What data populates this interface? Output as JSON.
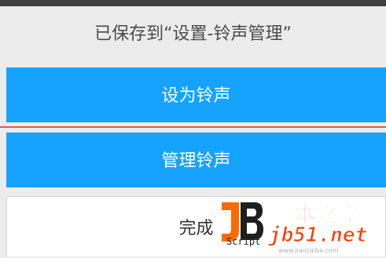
{
  "dialog": {
    "message": "已保存到“设置-铃声管理”",
    "set_ringtone_label": "设为铃声",
    "manage_ringtones_label": "管理铃声",
    "done_label": "完成"
  },
  "watermark": {
    "site_cn": "脚本之家",
    "site_url": "jb51.net",
    "logo_text": "Script",
    "sub_url": "www.jiaozaiba.com"
  },
  "colors": {
    "button_blue": "#16a3ff",
    "divider_red": "#e0585f",
    "background": "#ececec",
    "watermark_orange": "#ff3b00"
  }
}
